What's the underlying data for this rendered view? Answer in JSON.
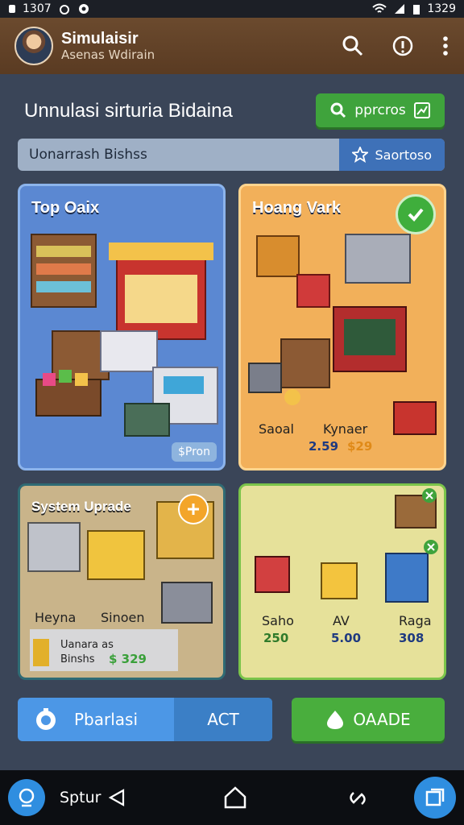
{
  "status_bar": {
    "time_left": "1307",
    "time_right": "1329"
  },
  "app_bar": {
    "title": "Simulaisir",
    "subtitle": "Asenas Wdirain"
  },
  "header": {
    "headline": "Unnulasi sirturia Bidaina",
    "action_label": "pprcros"
  },
  "search": {
    "value": "Uonarrash Bishss",
    "chip_label": "Saortoso"
  },
  "cards": [
    {
      "title": "Top Oaix",
      "price_chip": "$Pron"
    },
    {
      "title": "Hoang Vark",
      "items": [
        {
          "label": "Saoal",
          "price": "2.59"
        },
        {
          "label": "Kynaer",
          "price": "$29"
        }
      ]
    },
    {
      "title": "System Uprade",
      "items": [
        {
          "label": "Heyna"
        },
        {
          "label": "Sinoen"
        }
      ],
      "info_line1": "Uanara as",
      "info_line2": "Binshs",
      "info_price": "$ 329"
    },
    {
      "items": [
        {
          "label": "Saho",
          "price": "250"
        },
        {
          "label": "AV",
          "price": "5.00"
        },
        {
          "label": "Raga",
          "price": "308"
        }
      ]
    }
  ],
  "bottom": {
    "left_label": "Pbarlasi",
    "act_label": "ACT",
    "right_label": "OAADE"
  },
  "navbar": {
    "label": "Sptur"
  },
  "colors": {
    "background": "#3a4558",
    "appbar": "#6b4a2e",
    "green": "#3fa33c",
    "blue": "#4c97e6"
  }
}
